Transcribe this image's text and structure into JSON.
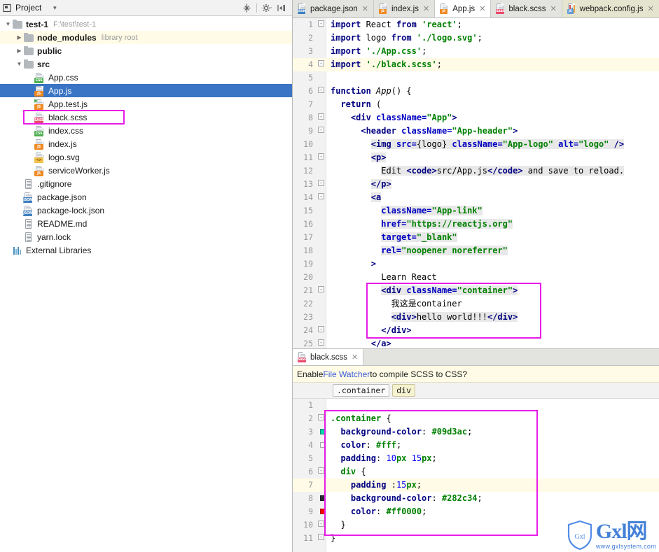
{
  "sidebar": {
    "header": {
      "title": "Project",
      "caret_icon": "chevron-down-icon",
      "collapse_all_icon": "collapse-all-icon",
      "settings_icon": "gear-icon",
      "hide_icon": "hide-panel-icon"
    },
    "tree": [
      {
        "label": "test-1",
        "sub": "F:\\test\\test-1",
        "icon": "folder-icon",
        "indent": 0,
        "arrow": "expanded",
        "bold": true
      },
      {
        "label": "node_modules",
        "sub": "library root",
        "icon": "folder-icon",
        "indent": 1,
        "arrow": "collapsed",
        "bold": true,
        "highlight": "yellow"
      },
      {
        "label": "public",
        "sub": "",
        "icon": "folder-icon",
        "indent": 1,
        "arrow": "collapsed",
        "bold": true
      },
      {
        "label": "src",
        "sub": "",
        "icon": "folder-icon",
        "indent": 1,
        "arrow": "expanded",
        "bold": true
      },
      {
        "label": "App.css",
        "sub": "",
        "icon": "css-file-icon",
        "indent": 2,
        "arrow": "none"
      },
      {
        "label": "App.js",
        "sub": "",
        "icon": "js-file-icon",
        "indent": 2,
        "arrow": "none",
        "selected": true
      },
      {
        "label": "App.test.js",
        "sub": "",
        "icon": "js-test-file-icon",
        "indent": 2,
        "arrow": "none"
      },
      {
        "label": "black.scss",
        "sub": "",
        "icon": "sass-file-icon",
        "indent": 2,
        "arrow": "none",
        "boxed": true
      },
      {
        "label": "index.css",
        "sub": "",
        "icon": "css-file-icon",
        "indent": 2,
        "arrow": "none"
      },
      {
        "label": "index.js",
        "sub": "",
        "icon": "js-file-icon",
        "indent": 2,
        "arrow": "none"
      },
      {
        "label": "logo.svg",
        "sub": "",
        "icon": "svg-file-icon",
        "indent": 2,
        "arrow": "none"
      },
      {
        "label": "serviceWorker.js",
        "sub": "",
        "icon": "js-file-icon",
        "indent": 2,
        "arrow": "none"
      },
      {
        "label": ".gitignore",
        "sub": "",
        "icon": "text-file-icon",
        "indent": 1,
        "arrow": "none"
      },
      {
        "label": "package.json",
        "sub": "",
        "icon": "json-file-icon",
        "indent": 1,
        "arrow": "none"
      },
      {
        "label": "package-lock.json",
        "sub": "",
        "icon": "json-file-icon",
        "indent": 1,
        "arrow": "none"
      },
      {
        "label": "README.md",
        "sub": "",
        "icon": "text-file-icon",
        "indent": 1,
        "arrow": "none"
      },
      {
        "label": "yarn.lock",
        "sub": "",
        "icon": "text-file-icon",
        "indent": 1,
        "arrow": "none"
      },
      {
        "label": "External Libraries",
        "sub": "",
        "icon": "libraries-icon",
        "indent": 0,
        "arrow": "none"
      }
    ]
  },
  "editor": {
    "tabs": [
      {
        "label": "package.json",
        "icon": "json-file-icon",
        "state": "inactive"
      },
      {
        "label": "index.js",
        "icon": "js-file-icon",
        "state": "inactive"
      },
      {
        "label": "App.js",
        "icon": "js-file-icon",
        "state": "active"
      },
      {
        "label": "black.scss",
        "icon": "sass-file-icon",
        "state": "inactive"
      },
      {
        "label": "webpack.config.js",
        "icon": "webpack-file-icon",
        "state": "olive"
      }
    ],
    "close_icon": "close-icon",
    "current_line": 4,
    "lines": [
      {
        "n": 1,
        "fold": "-",
        "html": "<span class=\"kw\">import</span> React <span class=\"kw\">from</span> <span class=\"str\">'react'</span>;"
      },
      {
        "n": 2,
        "fold": "",
        "html": "<span class=\"kw\">import</span> logo <span class=\"kw\">from</span> <span class=\"str\">'./logo.svg'</span>;"
      },
      {
        "n": 3,
        "fold": "",
        "html": "<span class=\"kw\">import</span> <span class=\"str\">'./App.css'</span>;"
      },
      {
        "n": 4,
        "fold": "-",
        "html": "<span class=\"kw\">import</span> <span class=\"str\">'./black.scss'</span>;"
      },
      {
        "n": 5,
        "fold": "",
        "html": ""
      },
      {
        "n": 6,
        "fold": "-",
        "html": "<span class=\"kw\">function</span> <span class=\"fn\">App</span>() {"
      },
      {
        "n": 7,
        "fold": "",
        "html": "  <span class=\"kw\">return</span> ("
      },
      {
        "n": 8,
        "fold": "-",
        "html": "    <span class=\"tag\">&lt;div</span> <span class=\"attr\">className=</span><span class=\"val\">\"App\"</span><span class=\"tag\">&gt;</span>"
      },
      {
        "n": 9,
        "fold": "-",
        "html": "      <span class=\"tag\">&lt;header</span> <span class=\"attr\">className=</span><span class=\"val\">\"App-header\"</span><span class=\"tag\">&gt;</span>"
      },
      {
        "n": 10,
        "fold": "",
        "html": "        <span class=\"sel\"><span class=\"tag\">&lt;img</span> <span class=\"attr\">src=</span>{logo} <span class=\"attr\">className=</span><span class=\"val\">\"App-logo\"</span> <span class=\"attr\">alt=</span><span class=\"val\">\"logo\"</span> <span class=\"tag\">/&gt;</span></span>"
      },
      {
        "n": 11,
        "fold": "-",
        "html": "        <span class=\"sel\"><span class=\"tag\">&lt;p&gt;</span></span>"
      },
      {
        "n": 12,
        "fold": "",
        "html": "          <span class=\"sel\">Edit <span class=\"tag\">&lt;code&gt;</span>src/App.js<span class=\"tag\">&lt;/code&gt;</span> and save to reload.</span>"
      },
      {
        "n": 13,
        "fold": "-",
        "html": "        <span class=\"sel\"><span class=\"tag\">&lt;/p&gt;</span></span>"
      },
      {
        "n": 14,
        "fold": "-",
        "html": "        <span class=\"sel\"><span class=\"tag\">&lt;a</span></span>"
      },
      {
        "n": 15,
        "fold": "",
        "html": "          <span class=\"sel\"><span class=\"attr\">className=</span><span class=\"val\">\"App-link\"</span></span>"
      },
      {
        "n": 16,
        "fold": "",
        "html": "          <span class=\"sel\"><span class=\"attr\">href=</span><span class=\"val\">\"https://reactjs.org\"</span></span>"
      },
      {
        "n": 17,
        "fold": "",
        "html": "          <span class=\"sel\"><span class=\"attr\">target=</span><span class=\"val\">\"_blank\"</span></span>"
      },
      {
        "n": 18,
        "fold": "",
        "html": "          <span class=\"sel\"><span class=\"attr\">rel=</span><span class=\"val\">\"noopener noreferrer\"</span></span>"
      },
      {
        "n": 19,
        "fold": "",
        "html": "        <span class=\"tag\">&gt;</span>"
      },
      {
        "n": 20,
        "fold": "",
        "html": "          Learn React"
      },
      {
        "n": 21,
        "fold": "-",
        "html": "          <span class=\"sel\"><span class=\"tag\">&lt;div</span> <span class=\"attr\">className=</span><span class=\"val\">\"container\"</span><span class=\"tag\">&gt;</span></span>"
      },
      {
        "n": 22,
        "fold": "",
        "html": "            我这是container"
      },
      {
        "n": 23,
        "fold": "",
        "html": "            <span class=\"sel\"><span class=\"tag\">&lt;div&gt;</span>hello world!!!<span class=\"tag\">&lt;/div&gt;</span></span>"
      },
      {
        "n": 24,
        "fold": "-",
        "html": "          <span class=\"tag\">&lt;/div&gt;</span>"
      },
      {
        "n": 25,
        "fold": "-",
        "html": "        <span class=\"tag\">&lt;/a&gt;</span>"
      }
    ],
    "plain_lines": [
      "import React from 'react';",
      "import logo from './logo.svg';",
      "import './App.css';",
      "import './black.scss';",
      "",
      "function App() {",
      "  return (",
      "    <div className=\"App\">",
      "      <header className=\"App-header\">",
      "        <img src={logo} className=\"App-logo\" alt=\"logo\" />",
      "        <p>",
      "          Edit <code>src/App.js</code> and save to reload.",
      "        </p>",
      "        <a",
      "          className=\"App-link\"",
      "          href=\"https://reactjs.org\"",
      "          target=\"_blank\"",
      "          rel=\"noopener noreferrer\"",
      "        >",
      "          Learn React",
      "          <div className=\"container\">",
      "            我这是container",
      "            <div>hello world!!!</div>",
      "          </div>",
      "        </a>"
    ]
  },
  "bottom_panel": {
    "tab": {
      "label": "black.scss",
      "icon": "sass-file-icon",
      "close_icon": "close-icon"
    },
    "notification": {
      "before": "Enable ",
      "link": "File Watcher",
      "after": " to compile SCSS to CSS?"
    },
    "breadcrumbs": [
      {
        "label": ".container",
        "style": "plain"
      },
      {
        "label": "div",
        "style": "olive"
      }
    ],
    "current_line": 7,
    "lines": [
      {
        "n": 1,
        "fold": "",
        "marker": "",
        "html": ""
      },
      {
        "n": 2,
        "fold": "-",
        "marker": "",
        "html": "<span class=\"cls\">.container</span> {"
      },
      {
        "n": 3,
        "fold": "",
        "marker": "#09d3ac",
        "html": "  <span class=\"prop\">background-color</span>: <span class=\"val\">#09d3ac</span>;"
      },
      {
        "n": 4,
        "fold": "",
        "marker": "#ffffff",
        "html": "  <span class=\"prop\">color</span>: <span class=\"val\">#fff</span>;"
      },
      {
        "n": 5,
        "fold": "",
        "marker": "",
        "html": "  <span class=\"prop\">padding</span>: <span class=\"num\">10</span><span class=\"val\">px</span> <span class=\"num\">15</span><span class=\"val\">px</span>;"
      },
      {
        "n": 6,
        "fold": "-",
        "marker": "",
        "html": "  <span class=\"cls\">div</span> {"
      },
      {
        "n": 7,
        "fold": "",
        "marker": "",
        "html": "    <span class=\"prop\">padding</span> :<span class=\"num\">15</span><span class=\"val\">px</span>;"
      },
      {
        "n": 8,
        "fold": "",
        "marker": "#282c34",
        "html": "    <span class=\"prop\">background-color</span>: <span class=\"val\">#282c34</span>;"
      },
      {
        "n": 9,
        "fold": "",
        "marker": "#ff0000",
        "html": "    <span class=\"prop\">color</span>: <span class=\"val\">#ff0000</span>;"
      },
      {
        "n": 10,
        "fold": "-",
        "marker": "",
        "html": "  }"
      },
      {
        "n": 11,
        "fold": "-",
        "marker": "",
        "html": "}"
      }
    ],
    "plain_lines": [
      "",
      ".container {",
      "  background-color: #09d3ac;",
      "  color: #fff;",
      "  padding: 10px 15px;",
      "  div {",
      "    padding :15px;",
      "    background-color: #282c34;",
      "    color: #ff0000;",
      "  }",
      "}"
    ]
  },
  "watermark": {
    "shield_text": "Gxl",
    "main_text": "Gxl",
    "cjk_text": "网",
    "url": "www.gxlsystem.com"
  },
  "colors": {
    "selection_blue": "#3a74c4",
    "highlight_magenta": "#e81ce8",
    "current_line_yellow": "#fffbe6",
    "toolbar_gray": "#e3e3e0",
    "gutter_gray": "#f2f2f2",
    "container_bg": "#09d3ac",
    "div_bg": "#282c34",
    "div_color": "#ff0000"
  }
}
